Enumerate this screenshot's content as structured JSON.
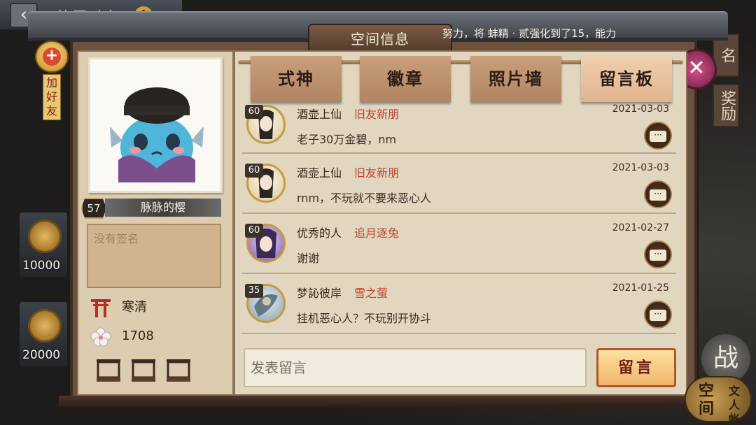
{
  "background": {
    "title": "协同对弈",
    "coins": [
      "10000",
      "20000"
    ],
    "right_labels": [
      "名",
      "奖励"
    ],
    "battle_label": "战",
    "space_badge": {
      "big": "空间",
      "small": "文人帐"
    }
  },
  "add_friend": {
    "label": "加好友"
  },
  "panel": {
    "title": "空间信息",
    "marquee": "努力，将 蚌精 · 贰强化到了15，能力"
  },
  "profile": {
    "level": "57",
    "name": "脉脉的樱",
    "signature_placeholder": "没有签名",
    "guild": "寒清",
    "likes": "1708"
  },
  "tabs": [
    {
      "label": "式神",
      "active": false
    },
    {
      "label": "徽章",
      "active": false
    },
    {
      "label": "照片墙",
      "active": false
    },
    {
      "label": "留言板",
      "active": true
    }
  ],
  "messages": [
    {
      "level": "60",
      "name": "酒壶上仙",
      "tag": "旧友新朋",
      "date": "2021-03-03",
      "text": "老子30万金碧，nm"
    },
    {
      "level": "60",
      "name": "酒壶上仙",
      "tag": "旧友新朋",
      "date": "2021-03-03",
      "text": "rnm，不玩就不要来恶心人"
    },
    {
      "level": "60",
      "name": "优秀的人",
      "tag": "追月逐兔",
      "date": "2021-02-27",
      "text": "谢谢"
    },
    {
      "level": "35",
      "name": "梦訫彼岸",
      "tag": "雪之萤",
      "date": "2021-01-25",
      "text": "挂机恶心人？不玩别开协斗"
    }
  ],
  "composer": {
    "placeholder": "发表留言",
    "send_label": "留言"
  },
  "colors": {
    "accent_red": "#c2422a",
    "active_tab": "#f0cfae",
    "send_border": "#b2572a"
  }
}
